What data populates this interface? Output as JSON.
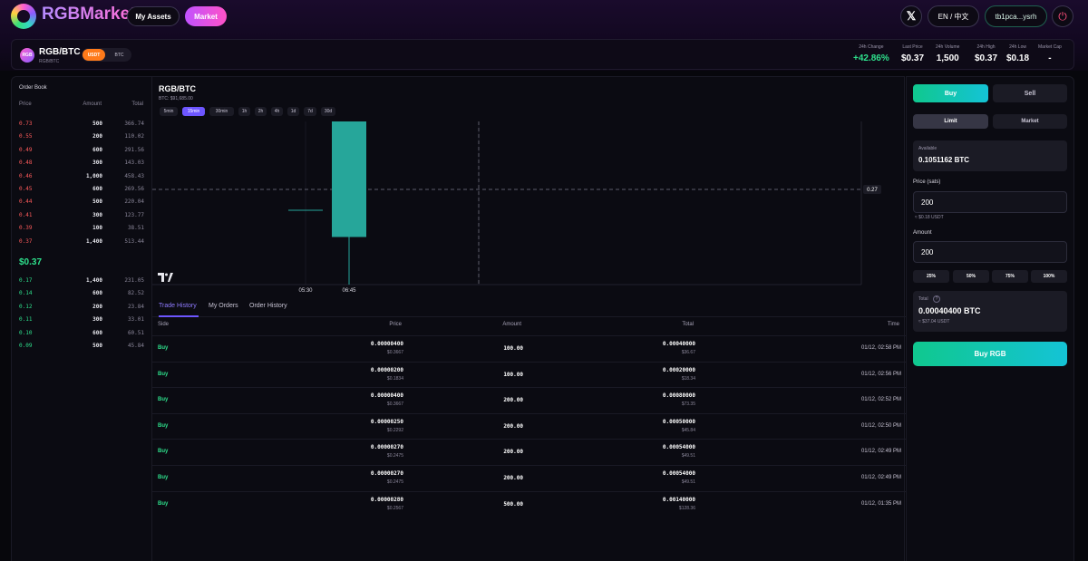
{
  "brand": {
    "name": "RGBMarket"
  },
  "nav": {
    "my_assets": "My Assets",
    "market": "Market"
  },
  "header": {
    "x_icon": "x-logo-icon",
    "language": "EN / 中文",
    "wallet": "tb1pca...ysrh",
    "logout_icon": "logout-icon"
  },
  "pair": {
    "icon_text": "RGB",
    "name": "RGB/BTC",
    "sub": "RGB/BTC",
    "quote_options": [
      "USDT",
      "BTC"
    ],
    "selected_quote": "USDT"
  },
  "stats": [
    {
      "label": "24h Change",
      "value": "+42.86%"
    },
    {
      "label": "Last Price",
      "value": "$0.37"
    },
    {
      "label": "24h Volume",
      "value": "1,500"
    },
    {
      "label": "24h High",
      "value": "$0.37"
    },
    {
      "label": "24h Low",
      "value": "$0.18"
    },
    {
      "label": "Market Cap",
      "value": "-"
    }
  ],
  "order_book": {
    "title": "Order Book",
    "headers": {
      "price": "Price",
      "amount": "Amount",
      "total": "Total"
    },
    "asks": [
      {
        "price": "0.73",
        "amount": "500",
        "total": "366.74"
      },
      {
        "price": "0.55",
        "amount": "200",
        "total": "110.02"
      },
      {
        "price": "0.49",
        "amount": "600",
        "total": "291.56"
      },
      {
        "price": "0.48",
        "amount": "300",
        "total": "143.03"
      },
      {
        "price": "0.46",
        "amount": "1,000",
        "total": "458.43"
      },
      {
        "price": "0.45",
        "amount": "600",
        "total": "269.56"
      },
      {
        "price": "0.44",
        "amount": "500",
        "total": "220.04"
      },
      {
        "price": "0.41",
        "amount": "300",
        "total": "123.77"
      },
      {
        "price": "0.39",
        "amount": "100",
        "total": "38.51"
      },
      {
        "price": "0.37",
        "amount": "1,400",
        "total": "513.44"
      }
    ],
    "mid_price": "$0.37",
    "bids": [
      {
        "price": "0.17",
        "amount": "1,400",
        "total": "231.05"
      },
      {
        "price": "0.14",
        "amount": "600",
        "total": "82.52"
      },
      {
        "price": "0.12",
        "amount": "200",
        "total": "23.84"
      },
      {
        "price": "0.11",
        "amount": "300",
        "total": "33.01"
      },
      {
        "price": "0.10",
        "amount": "600",
        "total": "60.51"
      },
      {
        "price": "0.09",
        "amount": "500",
        "total": "45.84"
      }
    ]
  },
  "chart": {
    "title": "RGB/BTC",
    "subtitle": "BTC: $91,685.00",
    "timeframes": [
      "5min",
      "15min",
      "30min",
      "1h",
      "2h",
      "4h",
      "1d",
      "7d",
      "30d"
    ],
    "active_timeframe": "15min",
    "x_labels": [
      "05:30",
      "06:45"
    ],
    "price_marker": "0.27",
    "logo_icon": "tradingview-logo-icon",
    "colors": {
      "up": "#26a69a",
      "grid": "#1b1b26"
    }
  },
  "chart_data": {
    "type": "candlestick",
    "x_ticks": [
      "05:30",
      "06:45"
    ],
    "candles": [
      {
        "open": 0.24,
        "high": 0.24,
        "low": 0.24,
        "close": 0.24
      },
      {
        "open": 0.2,
        "high": 0.37,
        "low": 0.13,
        "close": 0.37
      }
    ],
    "crosshair_y": 0.27,
    "ylim": [
      0.13,
      0.37
    ]
  },
  "trade_history": {
    "tabs": [
      "Trade History",
      "My Orders",
      "Order History"
    ],
    "active_tab": "Trade History",
    "headers": {
      "side": "Side",
      "price": "Price",
      "amount": "Amount",
      "total": "Total",
      "time": "Time"
    },
    "rows": [
      {
        "side": "Buy",
        "price": "0.00000400",
        "price_usd": "$0.3667",
        "amount": "100.00",
        "total": "0.00040000",
        "total_usd": "$36.67",
        "time": "01/12, 02:58 PM"
      },
      {
        "side": "Buy",
        "price": "0.00000200",
        "price_usd": "$0.1834",
        "amount": "100.00",
        "total": "0.00020000",
        "total_usd": "$18.34",
        "time": "01/12, 02:56 PM"
      },
      {
        "side": "Buy",
        "price": "0.00000400",
        "price_usd": "$0.3667",
        "amount": "200.00",
        "total": "0.00080000",
        "total_usd": "$73.35",
        "time": "01/12, 02:52 PM"
      },
      {
        "side": "Buy",
        "price": "0.00000250",
        "price_usd": "$0.2292",
        "amount": "200.00",
        "total": "0.00050000",
        "total_usd": "$45.84",
        "time": "01/12, 02:50 PM"
      },
      {
        "side": "Buy",
        "price": "0.00000270",
        "price_usd": "$0.2475",
        "amount": "200.00",
        "total": "0.00054000",
        "total_usd": "$49.51",
        "time": "01/12, 02:49 PM"
      },
      {
        "side": "Buy",
        "price": "0.00000270",
        "price_usd": "$0.2475",
        "amount": "200.00",
        "total": "0.00054000",
        "total_usd": "$49.51",
        "time": "01/12, 02:49 PM"
      },
      {
        "side": "Buy",
        "price": "0.00000280",
        "price_usd": "$0.2567",
        "amount": "500.00",
        "total": "0.00140000",
        "total_usd": "$128.36",
        "time": "01/12, 01:35 PM"
      }
    ]
  },
  "trade_form": {
    "side_tabs": [
      "Buy",
      "Sell"
    ],
    "active_side": "Buy",
    "order_types": [
      "Limit",
      "Market"
    ],
    "active_order_type": "Limit",
    "available_label": "Available",
    "available_value": "0.1051162 BTC",
    "price_label": "Price (sats)",
    "price_value": "200",
    "price_note": "≈ $0.18 USDT",
    "amount_label": "Amount",
    "amount_value": "200",
    "percent_buttons": [
      "25%",
      "50%",
      "75%",
      "100%"
    ],
    "total_label": "Total",
    "total_help": "?",
    "total_value": "0.00040400 BTC",
    "total_usd": "≈ $37.04 USDT",
    "submit_label": "Buy RGB"
  }
}
